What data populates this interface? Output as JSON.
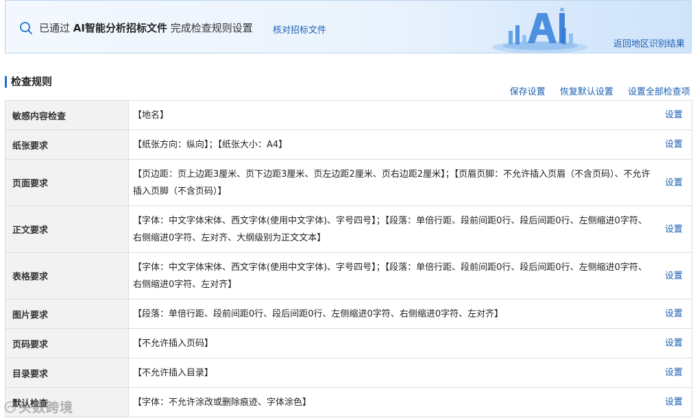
{
  "banner": {
    "prefix": "已通过",
    "highlight": "AI智能分析招标文件",
    "suffix": "完成检查规则设置",
    "verify_link": "核对招标文件",
    "return_link": "返回地区识别结果"
  },
  "section": {
    "title": "检查规则",
    "actions": [
      "保存设置",
      "恢复默认设置",
      "设置全部检查项"
    ]
  },
  "rules": [
    {
      "name": "敏感内容检查",
      "content": "【地名】",
      "action": "设置"
    },
    {
      "name": "纸张要求",
      "content": "【纸张方向：纵向】；【纸张大小：A4】",
      "action": "设置"
    },
    {
      "name": "页面要求",
      "content": "【页边距：页上边距3厘米、页下边距3厘米、页左边距2厘米、页右边距2厘米】；【页眉页脚：不允许插入页眉（不含页码）、不允许插入页脚（不含页码）】",
      "action": "设置"
    },
    {
      "name": "正文要求",
      "content": "【字体：中文字体宋体、西文字体(使用中文字体)、字号四号】；【段落：单倍行距、段前间距0行、段后间距0行、左侧缩进0字符、右侧缩进0字符、左对齐、大纲级别为正文文本】",
      "action": "设置"
    },
    {
      "name": "表格要求",
      "content": "【字体：中文字体宋体、西文字体(使用中文字体)、字号四号】；【段落：单倍行距、段前间距0行、段后间距0行、左侧缩进0字符、右侧缩进0字符、左对齐】",
      "action": "设置"
    },
    {
      "name": "图片要求",
      "content": "【段落：单倍行距、段前间距0行、段后间距0行、左侧缩进0字符、右侧缩进0字符、左对齐】",
      "action": "设置"
    },
    {
      "name": "页码要求",
      "content": "【不允许插入页码】",
      "action": "设置"
    },
    {
      "name": "目录要求",
      "content": "【不允许插入目录】",
      "action": "设置"
    },
    {
      "name": "默认检查",
      "content": "【字体：不允许涂改或删除痕迹、字体涂色】",
      "action": "设置"
    }
  ],
  "watermark": "头数跨境",
  "colors": {
    "link": "#1a5fb4",
    "accent": "#1a6fc9",
    "label_bg": "#f2f2f2",
    "banner_border": "#b9d3ee"
  }
}
